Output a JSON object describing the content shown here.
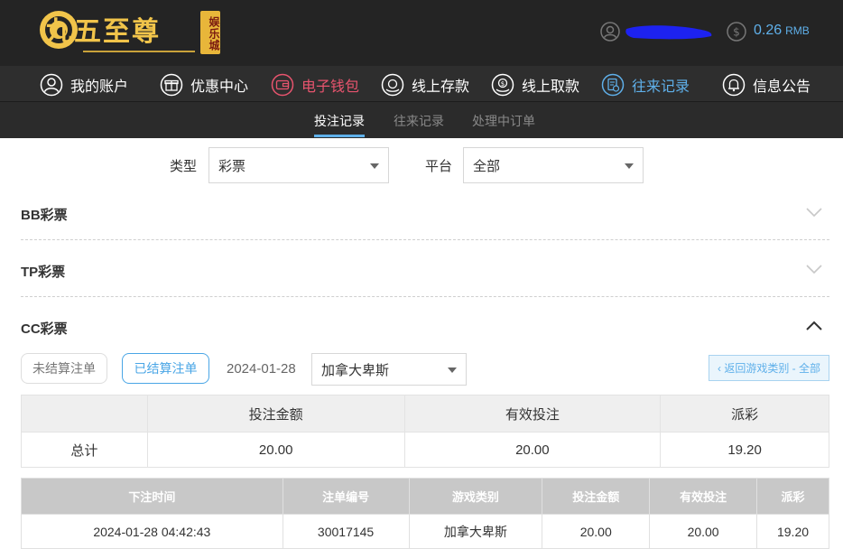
{
  "header": {
    "logo_text": "九五至尊",
    "logo_badge": "娱乐城",
    "balance_value": "0.26",
    "balance_unit": "RMB"
  },
  "nav": {
    "items": [
      {
        "label": "我的账户",
        "icon": "user-icon"
      },
      {
        "label": "优惠中心",
        "icon": "gift-icon"
      },
      {
        "label": "电子钱包",
        "icon": "wallet-icon"
      },
      {
        "label": "线上存款",
        "icon": "deposit-icon"
      },
      {
        "label": "线上取款",
        "icon": "withdraw-icon"
      },
      {
        "label": "往来记录",
        "icon": "records-icon"
      },
      {
        "label": "信息公告",
        "icon": "bell-icon"
      }
    ]
  },
  "subnav": {
    "items": [
      "投注记录",
      "往来记录",
      "处理中订单"
    ],
    "active": "投注记录"
  },
  "filters": {
    "type_label": "类型",
    "type_value": "彩票",
    "platform_label": "平台",
    "platform_value": "全部"
  },
  "sections": [
    "BB彩票",
    "TP彩票",
    "CC彩票"
  ],
  "bet_tabs": {
    "unsettled": "未结算注单",
    "settled": "已结算注单",
    "date": "2024-01-28",
    "game_value": "加拿大卑斯",
    "back_label": "‹ 返回游戏类别 - 全部"
  },
  "summary": {
    "headers": [
      "",
      "投注金额",
      "有效投注",
      "派彩"
    ],
    "row": [
      "总计",
      "20.00",
      "20.00",
      "19.20"
    ]
  },
  "records": {
    "headers": [
      "下注时间",
      "注单编号",
      "游戏类别",
      "投注金额",
      "有效投注",
      "派彩"
    ],
    "rows": [
      [
        "2024-01-28 04:42:43",
        "30017145",
        "加拿大卑斯",
        "20.00",
        "20.00",
        "19.20"
      ]
    ]
  },
  "colors": {
    "accent_blue": "#5fb0ea",
    "accent_red": "#e8546e",
    "gold": "#f1c44a",
    "header_bg": "#242424"
  }
}
